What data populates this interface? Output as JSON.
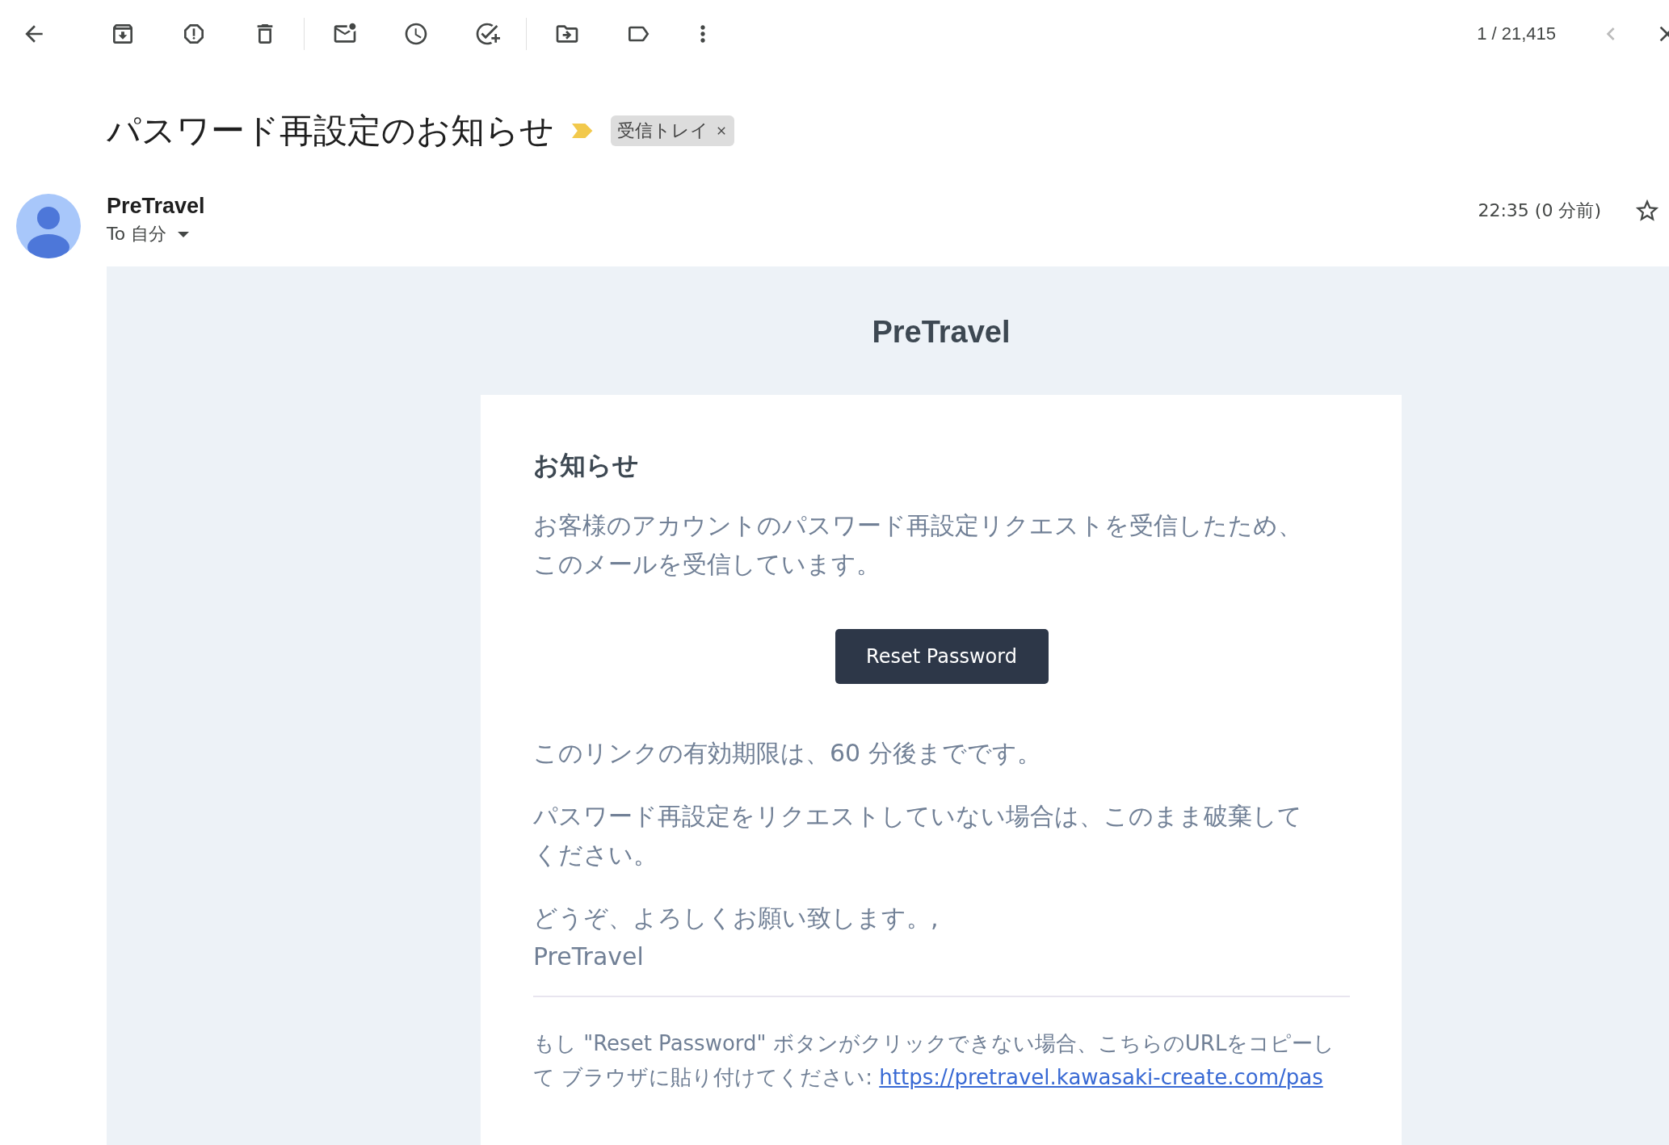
{
  "toolbar": {
    "counter": "1 / 21,415"
  },
  "message": {
    "subject": "パスワード再設定のお知らせ",
    "important": true,
    "labels": [
      {
        "text": "受信トレイ",
        "removable": true
      }
    ],
    "sender": {
      "name": "PreTravel",
      "recipient": "To 自分"
    },
    "time": "22:35 (0 分前)",
    "starred": false
  },
  "email": {
    "brand": "PreTravel",
    "heading": "お知らせ",
    "intro": "お客様のアカウントのパスワード再設定リクエストを受信したため、このメールを受信しています。",
    "button": "Reset Password",
    "paragraphs": [
      "このリンクの有効期限は、60 分後までです。",
      "パスワード再設定をリクエストしていない場合は、このまま破棄してください。"
    ],
    "signoff": [
      "どうぞ、よろしくお願い致します。,",
      "PreTravel"
    ],
    "footer": {
      "text": "もし \"Reset Password\" ボタンがクリックできない場合、こちらのURLをコピーして ブラウザに貼り付けてください: ",
      "link": "https://pretravel.kawasaki-create.com/pas"
    }
  }
}
